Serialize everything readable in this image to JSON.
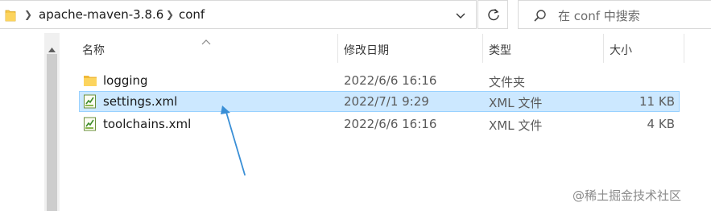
{
  "address_bar": {
    "segments": [
      "apache-maven-3.8.6",
      "conf"
    ]
  },
  "search": {
    "placeholder": "在 conf 中搜索"
  },
  "columns": {
    "name": "名称",
    "date": "修改日期",
    "type": "类型",
    "size": "大小"
  },
  "files": [
    {
      "name": "logging",
      "date": "2022/6/6 16:16",
      "type": "文件夹",
      "size": "",
      "icon": "folder-icon",
      "selected": false
    },
    {
      "name": "settings.xml",
      "date": "2022/7/1 9:29",
      "type": "XML 文件",
      "size": "11 KB",
      "icon": "xml-file-icon",
      "selected": true
    },
    {
      "name": "toolchains.xml",
      "date": "2022/6/6 16:16",
      "type": "XML 文件",
      "size": "4 KB",
      "icon": "xml-file-icon",
      "selected": false
    }
  ],
  "watermark": "@稀土掘金技术社区",
  "colors": {
    "selection_bg": "#cce8ff",
    "selection_border": "#99d1ff",
    "folder_yellow": "#f7c948",
    "annotation_arrow": "#3a8fd6"
  }
}
